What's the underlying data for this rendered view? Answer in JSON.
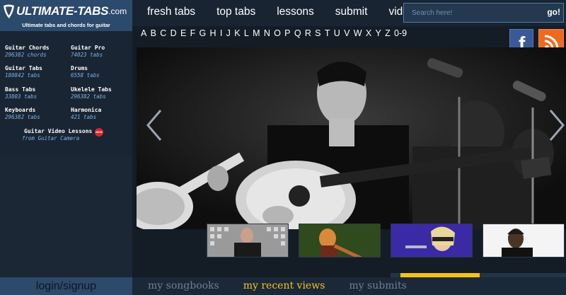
{
  "brand": {
    "logo_text": "ULTIMATE-TABS",
    "logo_domain": ".com",
    "tagline": "Ultimate tabs and chords for guitar"
  },
  "nav": {
    "items": [
      "fresh tabs",
      "top tabs",
      "lessons",
      "submit",
      "videos"
    ]
  },
  "search": {
    "placeholder": "Search here!",
    "button_label": "go!"
  },
  "sidebar": {
    "categories": [
      {
        "name": "Guitar Chords",
        "count": "296382 chords"
      },
      {
        "name": "Guitar Pro",
        "count": "74023 tabs"
      },
      {
        "name": "Guitar Tabs",
        "count": "180842 tabs"
      },
      {
        "name": "Drums",
        "count": "6558 tabs"
      },
      {
        "name": "Bass Tabs",
        "count": "33803 tabs"
      },
      {
        "name": "Ukelele Tabs",
        "count": "296382 tabs"
      },
      {
        "name": "Keyboards",
        "count": "296382 tabs"
      },
      {
        "name": "Harmonica",
        "count": "421 tabs"
      }
    ],
    "video": {
      "title": "Guitar Video Lessons",
      "subtitle": "from Guitar Camera",
      "badge": "NEW"
    }
  },
  "alphabet": [
    "A",
    "B",
    "C",
    "D",
    "E",
    "F",
    "G",
    "H",
    "I",
    "J",
    "K",
    "L",
    "M",
    "N",
    "O",
    "P",
    "Q",
    "R",
    "S",
    "T",
    "U",
    "V",
    "W",
    "X",
    "Y",
    "Z",
    "0-9"
  ],
  "social": {
    "facebook_icon": "facebook-icon",
    "rss_icon": "rss-icon",
    "facebook_color": "#3a5998",
    "rss_color": "#ef6a1f"
  },
  "carousel": {
    "prev_icon": "chevron-left-icon",
    "next_icon": "chevron-right-icon",
    "thumbnails": 4,
    "progress": 0.45
  },
  "account": {
    "login_label": "login/signup"
  },
  "bottom_tabs": [
    {
      "label": "my songbooks",
      "active": false
    },
    {
      "label": "my recent views",
      "active": true
    },
    {
      "label": "my submits",
      "active": false
    }
  ],
  "colors": {
    "accent": "#f3c317",
    "header_bg": "#192432",
    "logo_block": "#2c4a6b"
  }
}
